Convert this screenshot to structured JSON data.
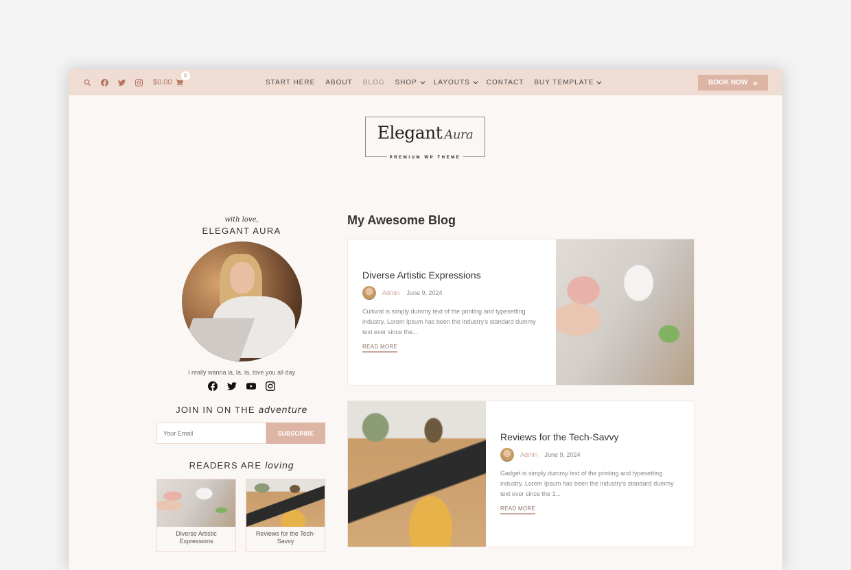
{
  "topbar": {
    "icons": [
      "search-icon",
      "facebook-icon",
      "twitter-icon",
      "instagram-icon"
    ],
    "cart_total": "$0.00",
    "cart_count": "0",
    "nav": [
      {
        "label": "START HERE",
        "dropdown": false,
        "active": false
      },
      {
        "label": "ABOUT",
        "dropdown": false,
        "active": false
      },
      {
        "label": "BLOG",
        "dropdown": false,
        "active": true
      },
      {
        "label": "SHOP",
        "dropdown": true,
        "active": false
      },
      {
        "label": "LAYOUTS",
        "dropdown": true,
        "active": false
      },
      {
        "label": "CONTACT",
        "dropdown": false,
        "active": false
      },
      {
        "label": "BUY TEMPLATE",
        "dropdown": true,
        "active": false
      }
    ],
    "book_now": "BOOK NOW",
    "book_now_icon": "»"
  },
  "logo": {
    "main": "Elegant",
    "script": "Aura",
    "sub": "PREMIUM WP THEME"
  },
  "sidebar": {
    "with_love": "with love,",
    "name": "ELEGANT AURA",
    "tagline": "I really wanna la, la, la, love you all day",
    "socials": [
      "facebook-icon",
      "twitter-icon",
      "youtube-icon",
      "instagram-icon"
    ],
    "join_prefix": "JOIN IN ON THE",
    "join_em": "adventure",
    "email_placeholder": "Your Email",
    "subscribe": "SUBSCRIBE",
    "readers_prefix": "READERS ARE",
    "readers_em": "loving",
    "thumbs": [
      {
        "caption": "Diverse Artistic Expressions"
      },
      {
        "caption": "Reviews for the Tech-Savvy"
      }
    ]
  },
  "main": {
    "title": "My Awesome Blog",
    "posts": [
      {
        "title": "Diverse Artistic Expressions",
        "author": "Admin",
        "date": "June 9, 2024",
        "excerpt": "Cultural  is simply dummy text of the printing and typesetting industry. Lorem Ipsum has been the industry's standard dummy text ever since the...",
        "read_more": "READ MORE"
      },
      {
        "title": "Reviews for the Tech-Savvy",
        "author": "Admin",
        "date": "June 9, 2024",
        "excerpt": "Gadget  is simply dummy text of the printing and typesetting industry. Lorem Ipsum has been the industry's standard dummy text ever since the 1...",
        "read_more": "READ MORE"
      }
    ]
  },
  "colors": {
    "topbar_bg": "#efdcd3",
    "accent": "#dcb5a5",
    "icon_accent": "#b77563",
    "page_bg": "#fbf7f5"
  }
}
